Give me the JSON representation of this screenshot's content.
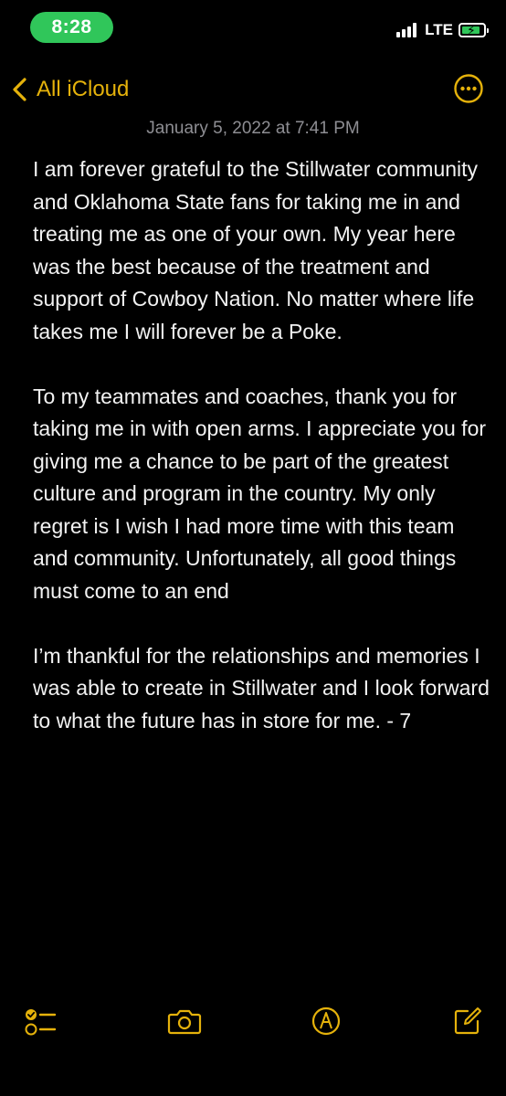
{
  "status_bar": {
    "time": "8:28",
    "network": "LTE",
    "battery_level": 0.85,
    "battery_color": "#30c65a"
  },
  "nav": {
    "back_label": "All iCloud",
    "accent_color": "#e5b20b"
  },
  "note": {
    "date": "January 5, 2022 at 7:41 PM",
    "paragraphs": [
      "I am forever grateful to the Stillwater community and Oklahoma State fans for taking me in and treating me as one of your own.  My year here was the best because of the treatment and support of Cowboy Nation.  No matter where life takes me I will forever be a Poke.",
      "To my teammates and coaches, thank you for taking me in with open arms.  I appreciate you for giving me a chance to be part of the greatest culture and program in the country.  My only regret is I wish I had more time with this team and community. Unfortunately, all good things must come to an end",
      "I’m thankful for the relationships and memories I was able to create in Stillwater and I look forward to what the future has in store for me. - 7"
    ]
  },
  "toolbar": {
    "icons": [
      "checklist-icon",
      "camera-icon",
      "markup-pen-icon",
      "compose-icon"
    ]
  }
}
